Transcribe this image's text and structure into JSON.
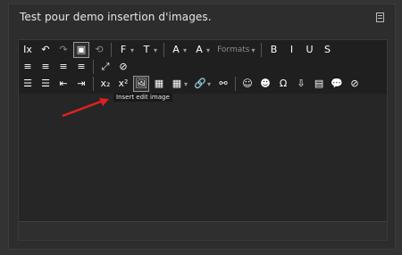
{
  "title": "Test pour demo insertion d'images.",
  "tooltip": "Insert edit image",
  "toolbar": {
    "row1": [
      {
        "name": "clear-formatting-icon",
        "glyph": "Ix"
      },
      {
        "name": "undo-icon",
        "glyph": "↶"
      },
      {
        "name": "redo-icon",
        "glyph": "↷",
        "dim": true
      },
      {
        "name": "paste-icon",
        "glyph": "▣",
        "active": true
      },
      {
        "name": "history-icon",
        "glyph": "⟲",
        "dim": true
      },
      {
        "sep": true
      },
      {
        "name": "font-family-icon",
        "glyph": "F",
        "dd": true
      },
      {
        "name": "font-size-icon",
        "glyph": "T",
        "dd": true
      },
      {
        "sep": true
      },
      {
        "name": "text-color-icon",
        "glyph": "A",
        "dd": true
      },
      {
        "name": "background-color-icon",
        "glyph": "A",
        "dd": true
      },
      {
        "name": "formats-dropdown",
        "text": "Formats",
        "dd": true
      },
      {
        "sep": true
      },
      {
        "name": "bold-icon",
        "glyph": "B"
      },
      {
        "name": "italic-icon",
        "glyph": "I"
      },
      {
        "name": "underline-icon",
        "glyph": "U"
      },
      {
        "name": "strikethrough-icon",
        "glyph": "S"
      }
    ],
    "row2": [
      {
        "name": "align-left-icon",
        "glyph": "≡"
      },
      {
        "name": "align-center-icon",
        "glyph": "≡"
      },
      {
        "name": "align-right-icon",
        "glyph": "≡"
      },
      {
        "name": "align-justify-icon",
        "glyph": "≡"
      },
      {
        "sep": true
      },
      {
        "name": "fullscreen-icon",
        "glyph": "⤢"
      },
      {
        "name": "remove-format-icon",
        "glyph": "⊘"
      }
    ],
    "row3": [
      {
        "name": "bullet-list-icon",
        "glyph": "☰"
      },
      {
        "name": "numbered-list-icon",
        "glyph": "☰"
      },
      {
        "name": "outdent-icon",
        "glyph": "⇤"
      },
      {
        "name": "indent-icon",
        "glyph": "⇥"
      },
      {
        "sep": true
      },
      {
        "name": "subscript-icon",
        "glyph": "x₂"
      },
      {
        "name": "superscript-icon",
        "glyph": "x²"
      },
      {
        "name": "insert-image-icon",
        "glyph": "🖼",
        "active": true
      },
      {
        "name": "insert-media-icon",
        "glyph": "▦"
      },
      {
        "name": "table-icon",
        "glyph": "▦",
        "dd": true
      },
      {
        "name": "link-icon",
        "glyph": "🔗",
        "dd": true
      },
      {
        "name": "unlink-icon",
        "glyph": "⚯"
      },
      {
        "sep": true
      },
      {
        "name": "emoticons-icon",
        "glyph": "☺"
      },
      {
        "name": "emoji-icon",
        "glyph": "☻"
      },
      {
        "name": "special-char-icon",
        "glyph": "Ω"
      },
      {
        "name": "upload-icon",
        "glyph": "⇩"
      },
      {
        "name": "file-icon",
        "glyph": "▤"
      },
      {
        "name": "comment-icon",
        "glyph": "💬"
      },
      {
        "name": "hide-icon",
        "glyph": "⊘"
      }
    ]
  }
}
